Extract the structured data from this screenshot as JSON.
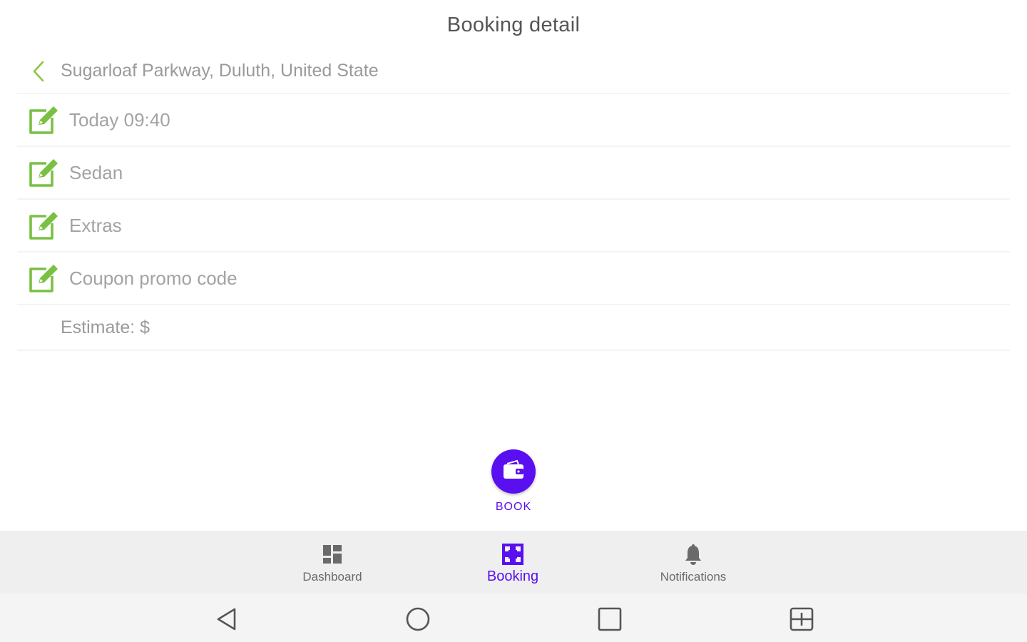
{
  "header": {
    "title": "Booking detail"
  },
  "address": {
    "text": "Sugarloaf Parkway, Duluth, United State",
    "back_icon": "chevron-left-icon"
  },
  "rows": [
    {
      "label": "Today 09:40",
      "icon": "edit-icon"
    },
    {
      "label": "Sedan",
      "icon": "edit-icon"
    },
    {
      "label": "Extras",
      "icon": "edit-icon"
    },
    {
      "label": "Coupon promo code",
      "icon": "edit-icon"
    }
  ],
  "estimate": {
    "label": "Estimate: $"
  },
  "book": {
    "label": "BOOK",
    "icon": "wallet-icon"
  },
  "bottom_nav": {
    "items": [
      {
        "label": "Dashboard",
        "icon": "dashboard-icon",
        "active": false
      },
      {
        "label": "Booking",
        "icon": "booking-icon",
        "active": true
      },
      {
        "label": "Notifications",
        "icon": "bell-icon",
        "active": false
      }
    ]
  },
  "system_nav": {
    "buttons": [
      "back-triangle-icon",
      "home-circle-icon",
      "recents-square-icon",
      "split-screen-icon"
    ]
  },
  "colors": {
    "accent": "#5a0ff0",
    "edit_green": "#7ac043",
    "text_gray": "#9a9a9a"
  }
}
